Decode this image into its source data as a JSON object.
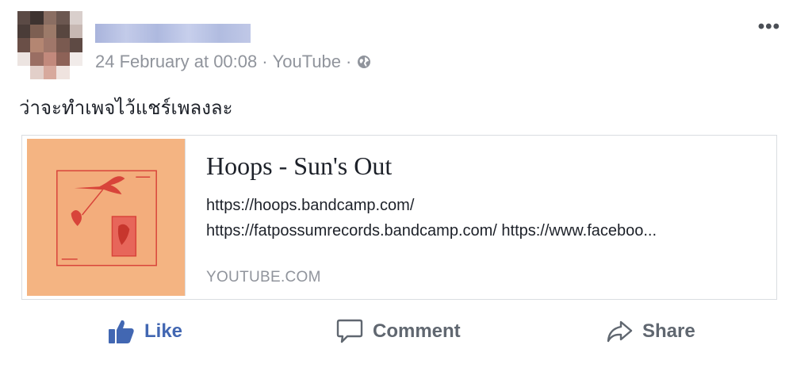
{
  "post": {
    "timestamp": "24 February at 00:08",
    "separator": "·",
    "source": "YouTube",
    "privacy_icon": "globe-icon",
    "more_label": "•••",
    "text": "ว่าจะทำเพจไว้แชร์เพลงละ"
  },
  "link_card": {
    "title": "Hoops - Sun's Out",
    "description_line1": "https://hoops.bandcamp.com/",
    "description_line2": "https://fatpossumrecords.bandcamp.com/ https://www.faceboo...",
    "domain": "YOUTUBE.COM"
  },
  "actions": {
    "like": "Like",
    "comment": "Comment",
    "share": "Share"
  },
  "colors": {
    "like_blue": "#4267b2",
    "meta_gray": "#90949c",
    "thumb_bg": "#f4b482",
    "thumb_ink": "#d8443a"
  }
}
